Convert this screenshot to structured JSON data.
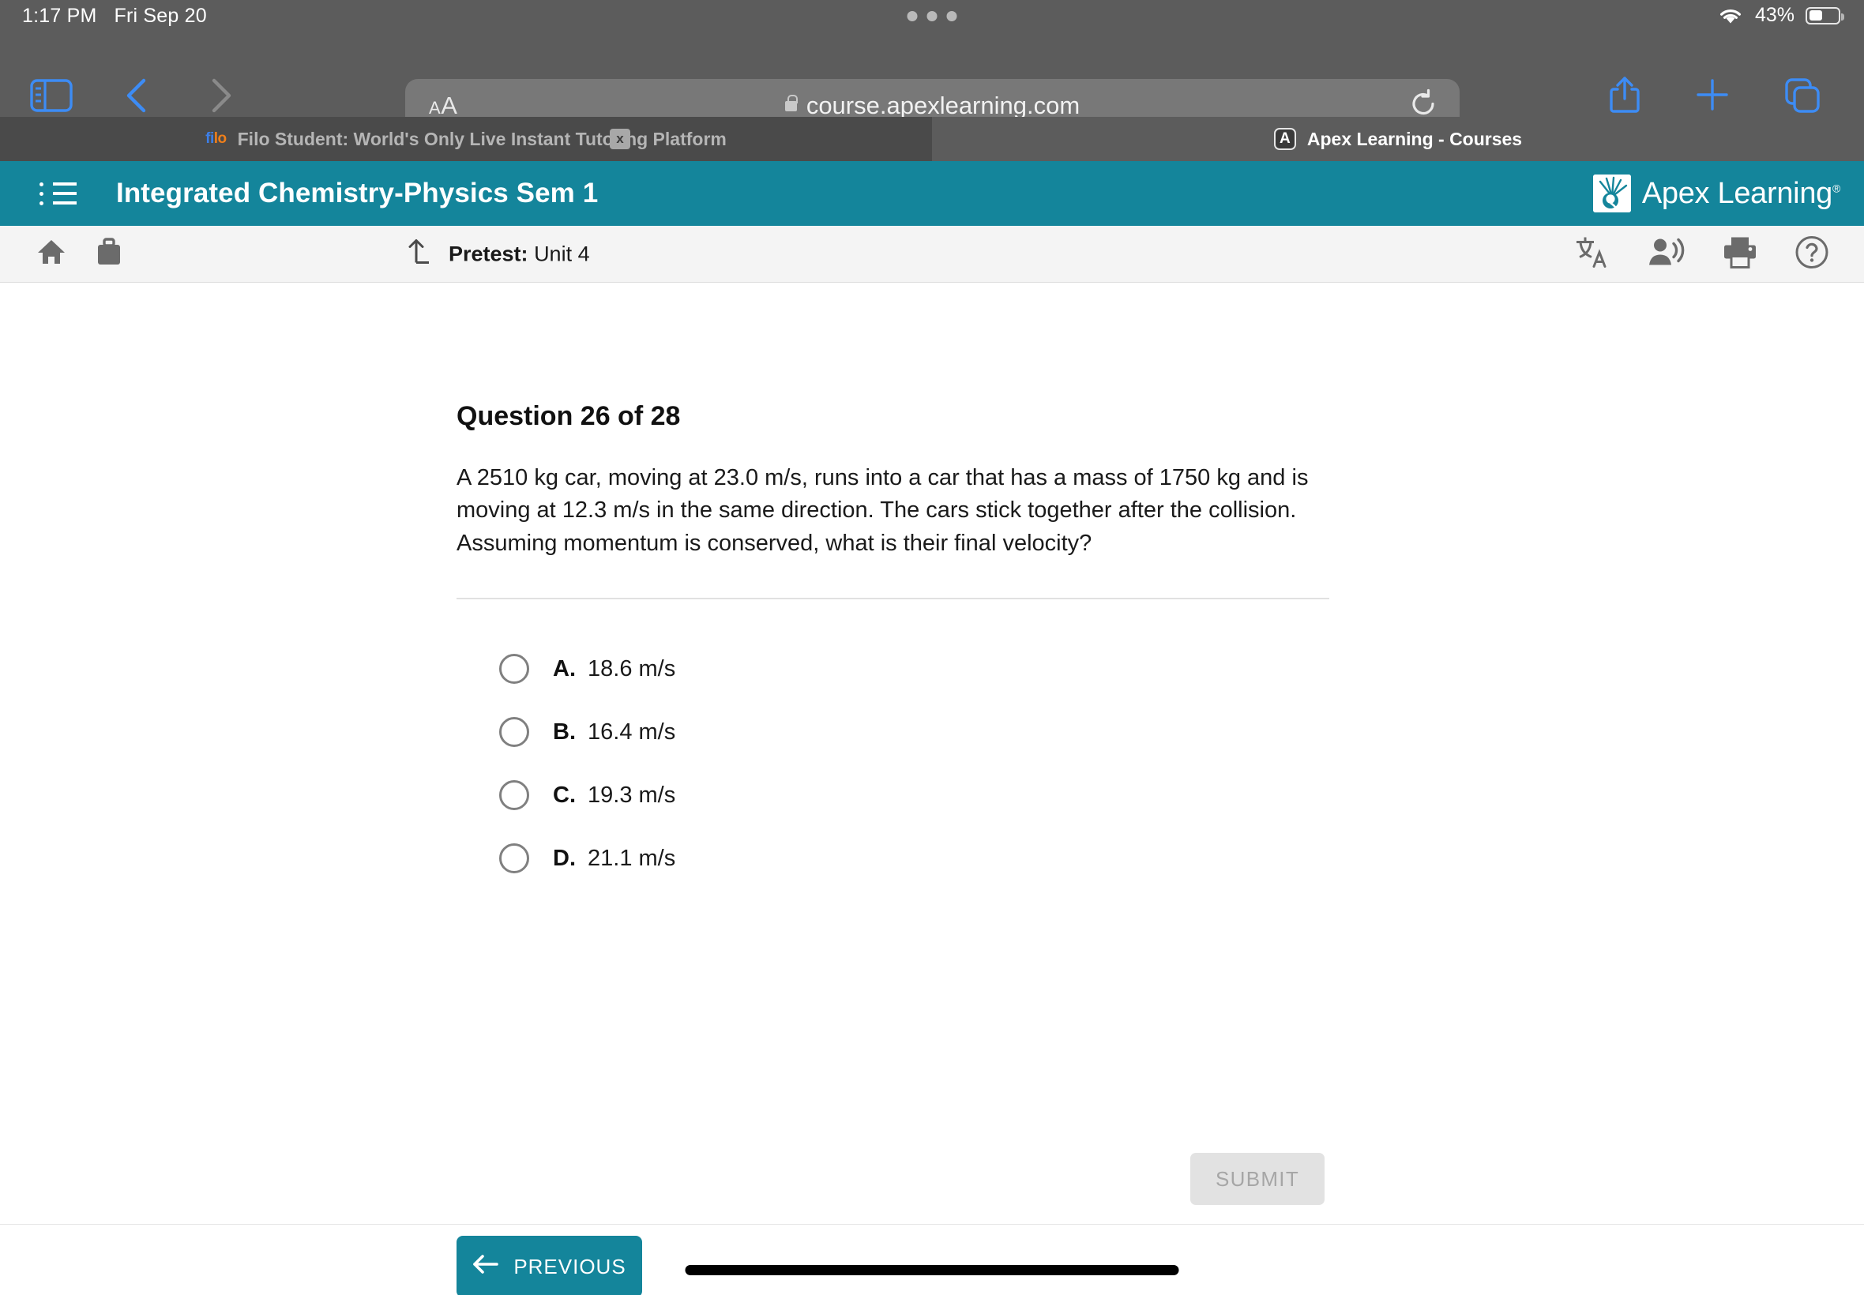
{
  "status_bar": {
    "time": "1:17 PM",
    "date": "Fri Sep 20",
    "battery_percent": "43%",
    "wifi_icon": "wifi-icon",
    "battery_icon": "battery-icon",
    "multitask_handle": "three-dots-handle"
  },
  "browser": {
    "sidebar_icon": "sidebar-icon",
    "back_icon": "chevron-left-icon",
    "forward_icon": "chevron-right-icon",
    "share_icon": "share-icon",
    "new_tab_icon": "plus-icon",
    "tabs_overview_icon": "tabs-overview-icon",
    "reader_label_small": "A",
    "reader_label_big": "A",
    "lock_icon": "lock-icon",
    "url": "course.apexlearning.com",
    "reload_icon": "reload-icon",
    "tabs": [
      {
        "title": "Filo Student: World's Only Live Instant Tutoring Platform",
        "favicon": "filo-favicon",
        "favicon_part1": "fi",
        "favicon_part2": "lo",
        "close_label": "x",
        "active": false
      },
      {
        "title": "Apex Learning - Courses",
        "favicon": "apex-favicon",
        "favicon_letter": "A",
        "active": true
      }
    ]
  },
  "app_header": {
    "menu_icon": "list-menu-icon",
    "course_title": "Integrated Chemistry-Physics Sem 1",
    "brand_name": "Apex Learning",
    "brand_registered": "®",
    "brand_logo_icon": "apex-sunburst-logo",
    "background_color": "#14859B"
  },
  "toolbar": {
    "home_icon": "home-icon",
    "briefcase_icon": "briefcase-icon",
    "activity_icon": "arrow-up-from-line-icon",
    "activity_type": "Pretest:",
    "activity_name": "Unit 4",
    "translate_icon": "translate-icon",
    "read_aloud_icon": "read-aloud-icon",
    "print_icon": "print-icon",
    "help_icon": "help-circle-icon"
  },
  "question": {
    "heading": "Question 26 of 28",
    "current": 26,
    "total": 28,
    "body": "A 2510 kg car, moving at 23.0 m/s, runs into a car that has a mass of 1750 kg and is moving at 12.3 m/s in the same direction. The cars stick together after the collision. Assuming momentum is conserved, what is their final velocity?",
    "options": [
      {
        "letter": "A.",
        "text": "18.6 m/s",
        "selected": false
      },
      {
        "letter": "B.",
        "text": "16.4 m/s",
        "selected": false
      },
      {
        "letter": "C.",
        "text": "19.3 m/s",
        "selected": false
      },
      {
        "letter": "D.",
        "text": "21.1 m/s",
        "selected": false
      }
    ]
  },
  "actions": {
    "submit_label": "SUBMIT",
    "submit_disabled": true,
    "previous_label": "PREVIOUS",
    "previous_icon": "arrow-left-icon"
  }
}
